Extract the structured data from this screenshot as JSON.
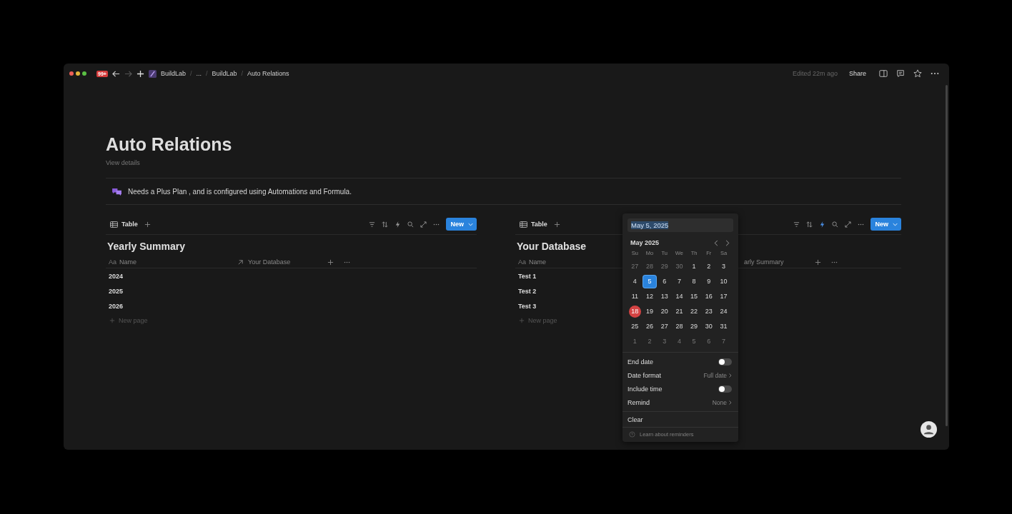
{
  "topbar": {
    "badge": "99+",
    "breadcrumbs": [
      "BuildLab",
      "...",
      "BuildLab",
      "Auto Relations"
    ],
    "separator": "/",
    "edited": "Edited 22m ago",
    "share": "Share"
  },
  "page": {
    "title": "Auto Relations",
    "details": "View details",
    "callout": "Needs a Plus Plan , and is configured using Automations and Formula."
  },
  "databases": [
    {
      "view": "Table",
      "automation_on": false,
      "new_button": "New",
      "title": "Yearly Summary",
      "columns": [
        {
          "kind": "title",
          "type_label": "Aa",
          "label": "Name"
        },
        {
          "kind": "relation",
          "label": "Your Database"
        }
      ],
      "rows": [
        "2024",
        "2025",
        "2026"
      ],
      "new_page": "New page"
    },
    {
      "view": "Table",
      "automation_on": true,
      "new_button": "New",
      "title": "Your Database",
      "columns": [
        {
          "kind": "title",
          "type_label": "Aa",
          "label": "Name"
        },
        {
          "kind": "relation_partial",
          "label": "arly Summary"
        }
      ],
      "rows": [
        "Test 1",
        "Test 2",
        "Test 3"
      ],
      "new_page": "New page"
    }
  ],
  "date_picker": {
    "value": "May 5, 2025",
    "month": "May 2025",
    "weekdays": [
      "Su",
      "Mo",
      "Tu",
      "We",
      "Th",
      "Fr",
      "Sa"
    ],
    "weeks": [
      [
        {
          "d": "27",
          "outside": true,
          "selected": false,
          "today": false
        },
        {
          "d": "28",
          "outside": true,
          "selected": false,
          "today": false
        },
        {
          "d": "29",
          "outside": true,
          "selected": false,
          "today": false
        },
        {
          "d": "30",
          "outside": true,
          "selected": false,
          "today": false
        },
        {
          "d": "1",
          "outside": false,
          "selected": false,
          "today": false
        },
        {
          "d": "2",
          "outside": false,
          "selected": false,
          "today": false
        },
        {
          "d": "3",
          "outside": false,
          "selected": false,
          "today": false
        }
      ],
      [
        {
          "d": "4",
          "outside": false,
          "selected": false,
          "today": false
        },
        {
          "d": "5",
          "outside": false,
          "selected": true,
          "today": false
        },
        {
          "d": "6",
          "outside": false,
          "selected": false,
          "today": false
        },
        {
          "d": "7",
          "outside": false,
          "selected": false,
          "today": false
        },
        {
          "d": "8",
          "outside": false,
          "selected": false,
          "today": false
        },
        {
          "d": "9",
          "outside": false,
          "selected": false,
          "today": false
        },
        {
          "d": "10",
          "outside": false,
          "selected": false,
          "today": false
        }
      ],
      [
        {
          "d": "11",
          "outside": false,
          "selected": false,
          "today": false
        },
        {
          "d": "12",
          "outside": false,
          "selected": false,
          "today": false
        },
        {
          "d": "13",
          "outside": false,
          "selected": false,
          "today": false
        },
        {
          "d": "14",
          "outside": false,
          "selected": false,
          "today": false
        },
        {
          "d": "15",
          "outside": false,
          "selected": false,
          "today": false
        },
        {
          "d": "16",
          "outside": false,
          "selected": false,
          "today": false
        },
        {
          "d": "17",
          "outside": false,
          "selected": false,
          "today": false
        }
      ],
      [
        {
          "d": "18",
          "outside": false,
          "selected": false,
          "today": true
        },
        {
          "d": "19",
          "outside": false,
          "selected": false,
          "today": false
        },
        {
          "d": "20",
          "outside": false,
          "selected": false,
          "today": false
        },
        {
          "d": "21",
          "outside": false,
          "selected": false,
          "today": false
        },
        {
          "d": "22",
          "outside": false,
          "selected": false,
          "today": false
        },
        {
          "d": "23",
          "outside": false,
          "selected": false,
          "today": false
        },
        {
          "d": "24",
          "outside": false,
          "selected": false,
          "today": false
        }
      ],
      [
        {
          "d": "25",
          "outside": false,
          "selected": false,
          "today": false
        },
        {
          "d": "26",
          "outside": false,
          "selected": false,
          "today": false
        },
        {
          "d": "27",
          "outside": false,
          "selected": false,
          "today": false
        },
        {
          "d": "28",
          "outside": false,
          "selected": false,
          "today": false
        },
        {
          "d": "29",
          "outside": false,
          "selected": false,
          "today": false
        },
        {
          "d": "30",
          "outside": false,
          "selected": false,
          "today": false
        },
        {
          "d": "31",
          "outside": false,
          "selected": false,
          "today": false
        }
      ],
      [
        {
          "d": "1",
          "outside": true,
          "selected": false,
          "today": false
        },
        {
          "d": "2",
          "outside": true,
          "selected": false,
          "today": false
        },
        {
          "d": "3",
          "outside": true,
          "selected": false,
          "today": false
        },
        {
          "d": "4",
          "outside": true,
          "selected": false,
          "today": false
        },
        {
          "d": "5",
          "outside": true,
          "selected": false,
          "today": false
        },
        {
          "d": "6",
          "outside": true,
          "selected": false,
          "today": false
        },
        {
          "d": "7",
          "outside": true,
          "selected": false,
          "today": false
        }
      ]
    ],
    "options": [
      {
        "kind": "toggle",
        "label": "End date",
        "on": false
      },
      {
        "kind": "select",
        "label": "Date format",
        "value": "Full date"
      },
      {
        "kind": "toggle",
        "label": "Include time",
        "on": false
      },
      {
        "kind": "select",
        "label": "Remind",
        "value": "None"
      }
    ],
    "clear": "Clear",
    "help": "Learn about reminders"
  }
}
